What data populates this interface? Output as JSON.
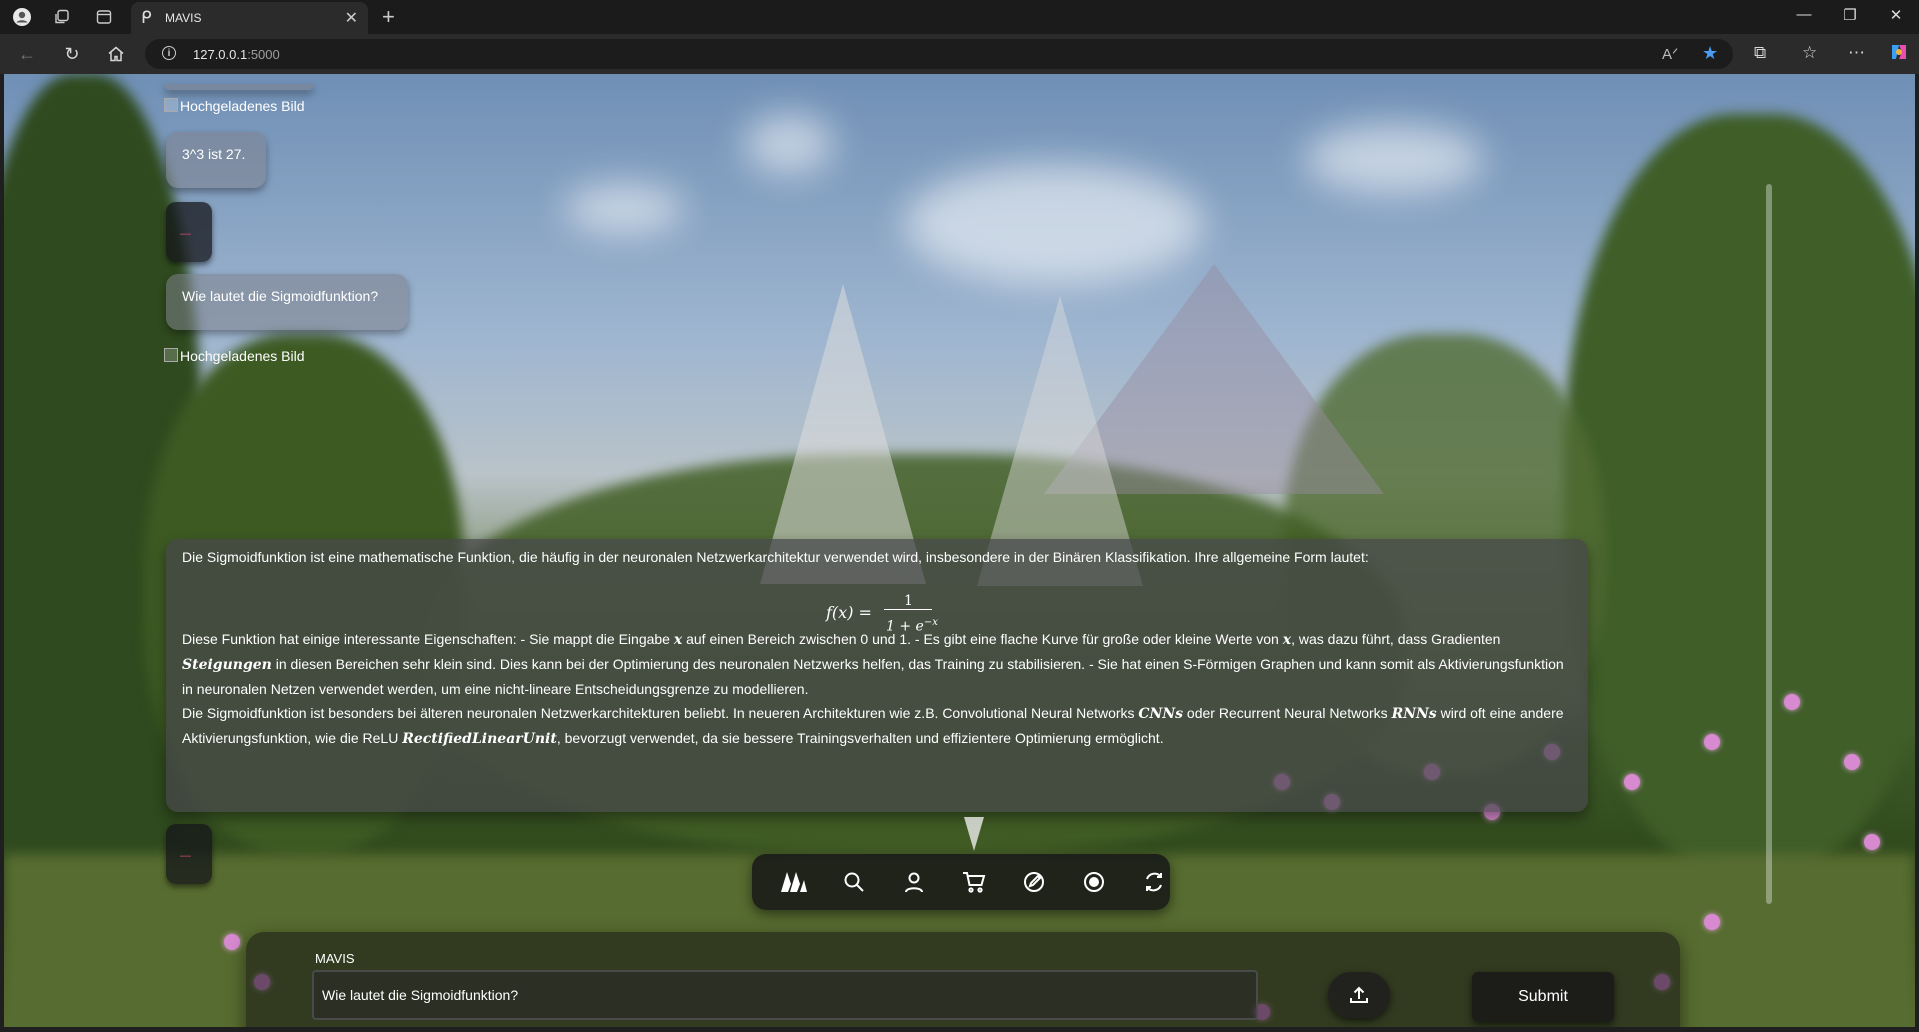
{
  "browser": {
    "tab_title": "MAVIS",
    "url_host": "127.0.0.1",
    "url_port": ":5000"
  },
  "chat": {
    "image_alt_1": "Hochgeladenes Bild",
    "reply_1": "3^3 ist 27.",
    "question_2": "Wie lautet die Sigmoidfunktion?",
    "image_alt_2": "Hochgeladenes Bild",
    "answer": {
      "intro": "Die Sigmoidfunktion ist eine mathematische Funktion, die häufig in der neuronalen Netzwerkarchitektur verwendet wird, insbesondere in der Binären Klassifikation. Ihre allgemeine Form lautet:",
      "formula_lhs": "f(x) =",
      "formula_num": "1",
      "formula_den": "1 + e",
      "formula_exp": "−x",
      "p2_a": "Diese Funktion hat einige interessante Eigenschaften: - Sie mappt die Eingabe ",
      "p2_x1": "x",
      "p2_b": " auf einen Bereich zwischen 0 und 1. - Es gibt eine flache Kurve für große oder kleine Werte von ",
      "p2_x2": "x",
      "p2_c": ", was dazu führt, dass Gradienten ",
      "p2_steig": "Steigungen",
      "p2_d": " in diesen Bereichen sehr klein sind. Dies kann bei der Optimierung des neuronalen Netzwerks helfen, das Training zu stabilisieren. - Sie hat einen S-Förmigen Graphen und kann somit als Aktivierungsfunktion in neuronalen Netzen verwendet werden, um eine nicht-lineare Entscheidungsgrenze zu modellieren.",
      "p3_a": "Die Sigmoidfunktion ist besonders bei älteren neuronalen Netzwerkarchitekturen beliebt. In neueren Architekturen wie z.B. Convolutional Neural Networks ",
      "p3_cnn": "CNNs",
      "p3_b": " oder Recurrent Neural Networks ",
      "p3_rnn": "RNNs",
      "p3_c": " wird oft eine andere Aktivierungsfunktion, wie die ReLU ",
      "p3_relu": "RectifiedLinearUnit",
      "p3_d": ", bevorzugt verwendet, da sie bessere Trainingsverhalten und effizientere Optimierung ermöglicht."
    }
  },
  "toolbar_icons": [
    "mavis-logo-icon",
    "search-icon",
    "user-icon",
    "cart-icon",
    "edit-icon",
    "record-icon",
    "refresh-icon"
  ],
  "input": {
    "label": "MAVIS",
    "value": "Wie lautet die Sigmoidfunktion?",
    "submit_label": "Submit"
  }
}
